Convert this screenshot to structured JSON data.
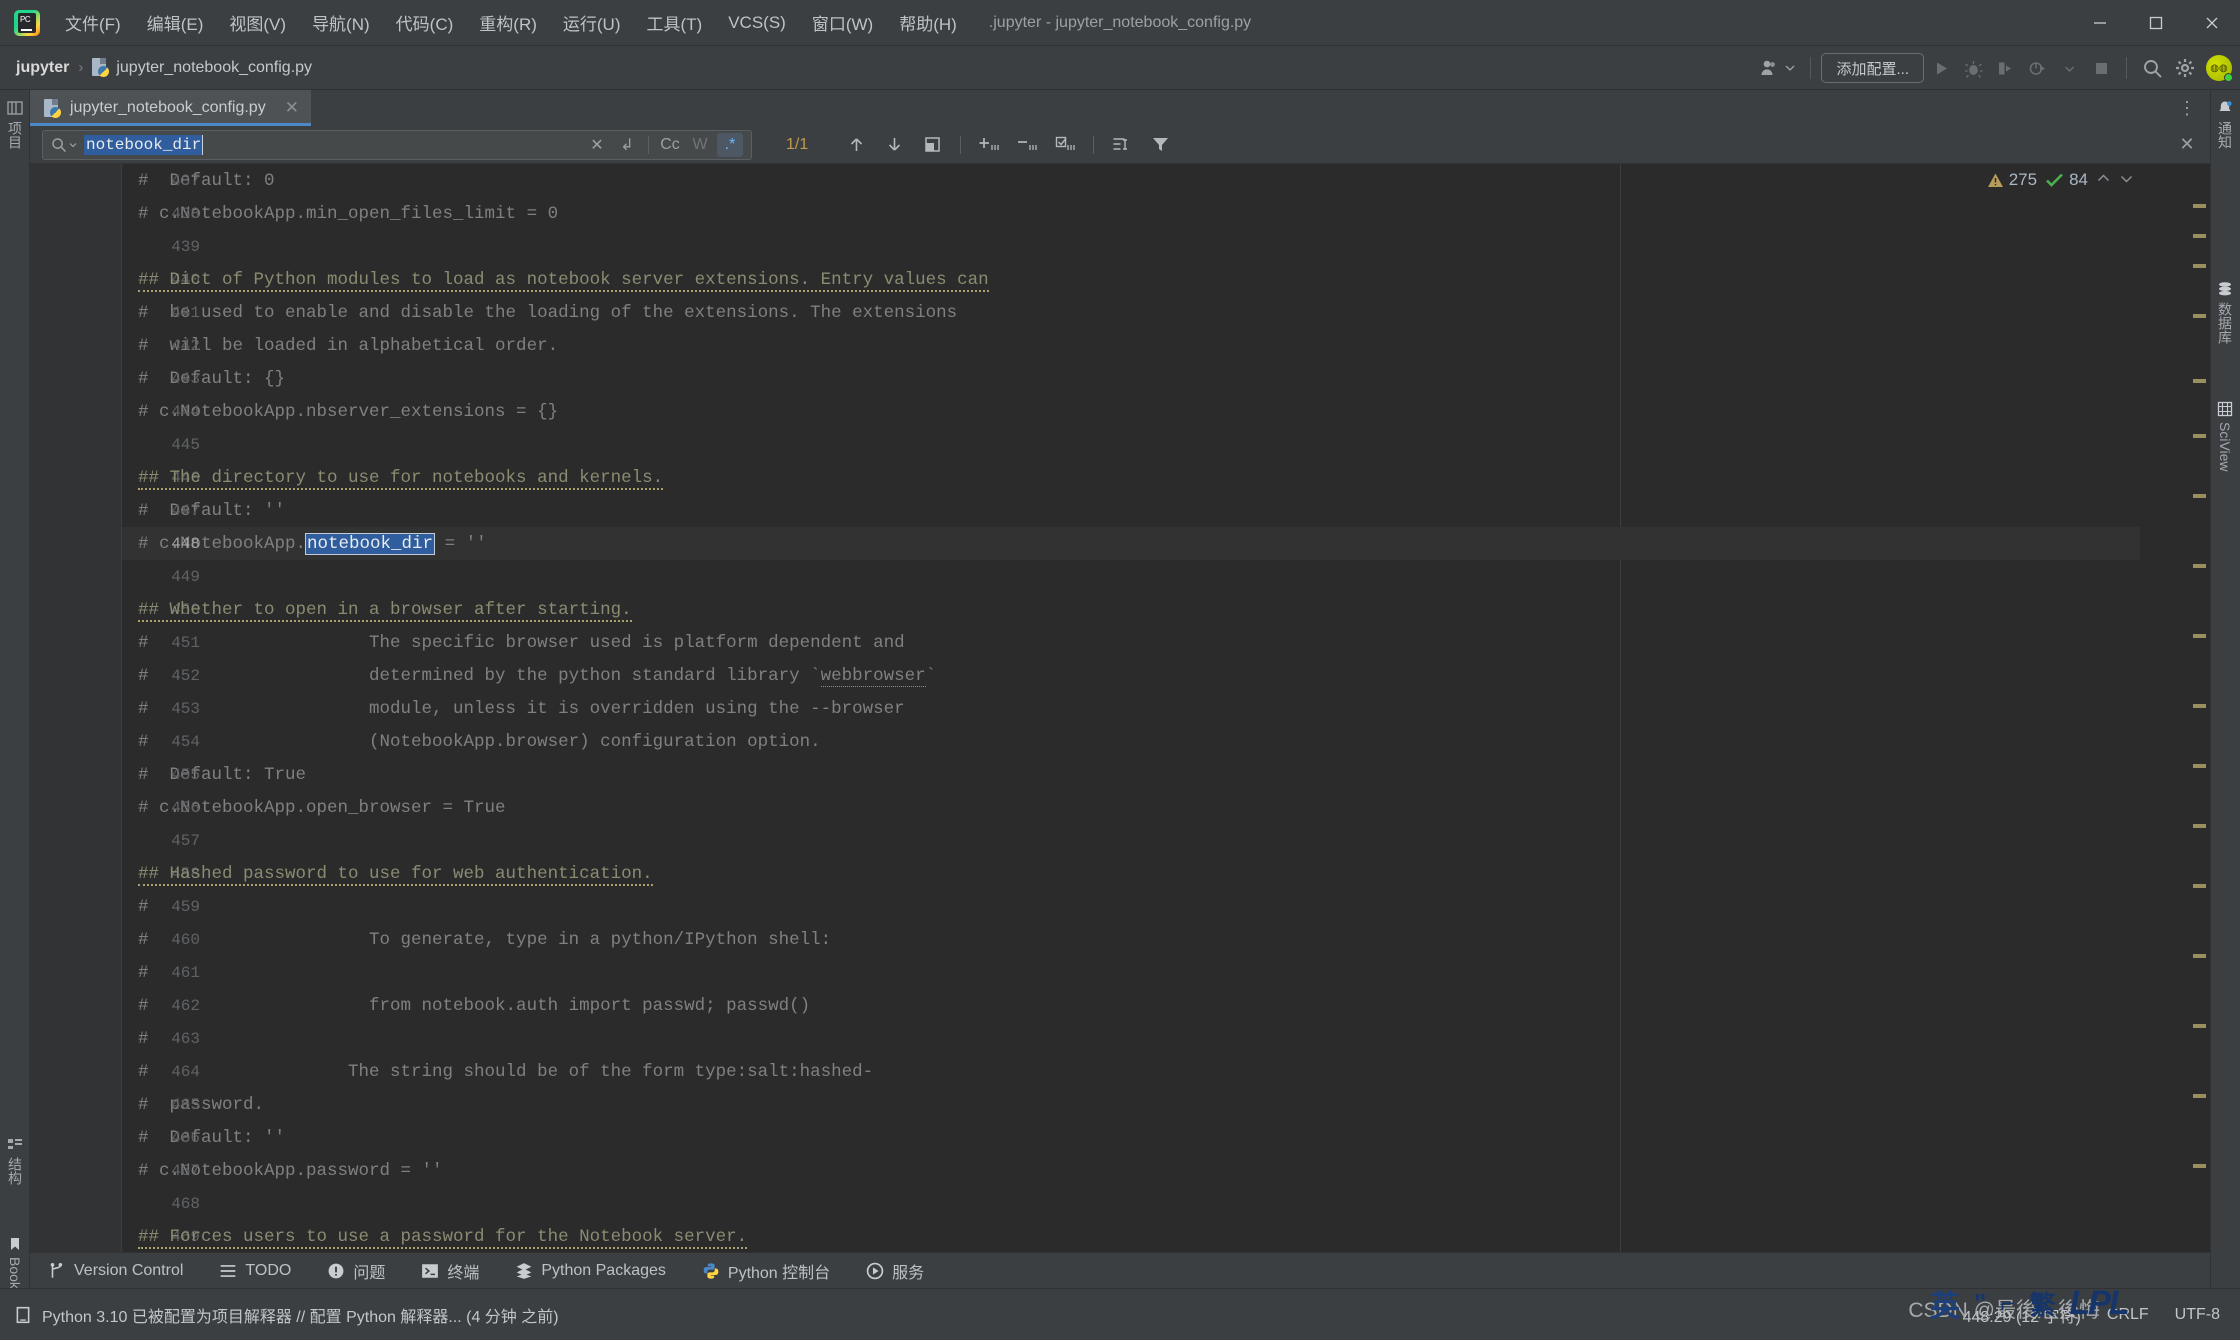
{
  "window": {
    "title": ".jupyter - jupyter_notebook_config.py",
    "minimize_label": "minimize",
    "maximize_label": "maximize",
    "close_label": "close"
  },
  "menubar": {
    "items": [
      {
        "label": "文件(F)",
        "name": "menu-file"
      },
      {
        "label": "编辑(E)",
        "name": "menu-edit"
      },
      {
        "label": "视图(V)",
        "name": "menu-view"
      },
      {
        "label": "导航(N)",
        "name": "menu-navigate"
      },
      {
        "label": "代码(C)",
        "name": "menu-code"
      },
      {
        "label": "重构(R)",
        "name": "menu-refactor"
      },
      {
        "label": "运行(U)",
        "name": "menu-run"
      },
      {
        "label": "工具(T)",
        "name": "menu-tools"
      },
      {
        "label": "VCS(S)",
        "name": "menu-vcs"
      },
      {
        "label": "窗口(W)",
        "name": "menu-window"
      },
      {
        "label": "帮助(H)",
        "name": "menu-help"
      }
    ]
  },
  "navbar": {
    "crumb_root": "jupyter",
    "crumb_sep": "›",
    "crumb_file": "jupyter_notebook_config.py",
    "add_config_label": "添加配置..."
  },
  "left_stripe": {
    "project_label": "项目",
    "structure_label": "结构",
    "bookmarks_label": "Bookmarks"
  },
  "right_stripe": {
    "notifications_label": "通知",
    "database_label": "数据库",
    "sciview_label": "SciView"
  },
  "editor_tabs": {
    "active_tab": "jupyter_notebook_config.py",
    "close_glyph": "✕",
    "kebab_glyph": "⋮"
  },
  "findbar": {
    "query": "notebook_dir",
    "clear_glyph": "✕",
    "history_glyph": "↲",
    "match_case_label": "Cc",
    "words_label": "W",
    "regex_label": ".*",
    "match_count": "1/1",
    "prev_title": "上一个",
    "next_title": "下一个",
    "close_glyph": "✕"
  },
  "inspections": {
    "warning_count": "275",
    "ok_count": "84"
  },
  "editor": {
    "lines": [
      {
        "no": "437",
        "text": "#  Default: 0",
        "kind": "comment"
      },
      {
        "no": "438",
        "text": "# c.NotebookApp.min_open_files_limit = 0",
        "kind": "comment"
      },
      {
        "no": "439",
        "text": "",
        "kind": "blank"
      },
      {
        "no": "440",
        "text": "## Dict of Python modules to load as notebook server extensions. Entry values can",
        "kind": "doc"
      },
      {
        "no": "441",
        "text": "#  be used to enable and disable the loading of the extensions. The extensions",
        "kind": "comment"
      },
      {
        "no": "442",
        "text": "#  will be loaded in alphabetical order.",
        "kind": "comment"
      },
      {
        "no": "443",
        "text": "#  Default: {}",
        "kind": "comment"
      },
      {
        "no": "444",
        "text": "# c.NotebookApp.nbserver_extensions = {}",
        "kind": "comment"
      },
      {
        "no": "445",
        "text": "",
        "kind": "blank"
      },
      {
        "no": "446",
        "text": "## The directory to use for notebooks and kernels.",
        "kind": "doc"
      },
      {
        "no": "447",
        "text": "#  Default: ''",
        "kind": "comment"
      },
      {
        "no": "448",
        "text": "# c.NotebookApp.notebook_dir = ''",
        "kind": "match",
        "prefix": "# c.NotebookApp.",
        "match": "notebook_dir",
        "suffix": " = ''"
      },
      {
        "no": "449",
        "text": "",
        "kind": "blank"
      },
      {
        "no": "450",
        "text": "## Whether to open in a browser after starting.",
        "kind": "doc"
      },
      {
        "no": "451",
        "text": "#                     The specific browser used is platform dependent and",
        "kind": "comment"
      },
      {
        "no": "452",
        "text": "#                     determined by the python standard library `webbrowser`",
        "kind": "comment-webbrowser"
      },
      {
        "no": "453",
        "text": "#                     module, unless it is overridden using the --browser",
        "kind": "comment"
      },
      {
        "no": "454",
        "text": "#                     (NotebookApp.browser) configuration option.",
        "kind": "comment"
      },
      {
        "no": "455",
        "text": "#  Default: True",
        "kind": "comment"
      },
      {
        "no": "456",
        "text": "# c.NotebookApp.open_browser = True",
        "kind": "comment"
      },
      {
        "no": "457",
        "text": "",
        "kind": "blank"
      },
      {
        "no": "458",
        "text": "## Hashed password to use for web authentication.",
        "kind": "doc"
      },
      {
        "no": "459",
        "text": "#",
        "kind": "comment"
      },
      {
        "no": "460",
        "text": "#                     To generate, type in a python/IPython shell:",
        "kind": "comment"
      },
      {
        "no": "461",
        "text": "#",
        "kind": "comment"
      },
      {
        "no": "462",
        "text": "#                     from notebook.auth import passwd; passwd()",
        "kind": "comment"
      },
      {
        "no": "463",
        "text": "#",
        "kind": "comment"
      },
      {
        "no": "464",
        "text": "#                   The string should be of the form type:salt:hashed-",
        "kind": "comment"
      },
      {
        "no": "465",
        "text": "#  password.",
        "kind": "comment"
      },
      {
        "no": "466",
        "text": "#  Default: ''",
        "kind": "comment"
      },
      {
        "no": "467",
        "text": "# c.NotebookApp.password = ''",
        "kind": "comment"
      },
      {
        "no": "468",
        "text": "",
        "kind": "blank"
      },
      {
        "no": "469",
        "text": "## Forces users to use a password for the Notebook server.",
        "kind": "doc"
      }
    ],
    "webbrowser_token": "webbrowser"
  },
  "bottom_tools": [
    {
      "label": "Version Control",
      "name": "bottom-tool-version-control"
    },
    {
      "label": "TODO",
      "name": "bottom-tool-todo"
    },
    {
      "label": "问题",
      "name": "bottom-tool-problems"
    },
    {
      "label": "终端",
      "name": "bottom-tool-terminal"
    },
    {
      "label": "Python Packages",
      "name": "bottom-tool-python-packages"
    },
    {
      "label": "Python 控制台",
      "name": "bottom-tool-python-console"
    },
    {
      "label": "服务",
      "name": "bottom-tool-services"
    }
  ],
  "statusbar": {
    "message": "Python 3.10 已被配置为项目解释器 // 配置 Python 解释器... (4 分钟 之前)",
    "caret": "448:29 (12 字符)",
    "line_sep": "CRLF",
    "encoding": "UTF-8"
  },
  "watermark": {
    "csdn": "CSDN @最後灬後悔",
    "ime_lang": "英",
    "ime_punct": "\"",
    "ime_half": "⌐",
    "ime_trad": "繁",
    "ime_logo": "LPL"
  },
  "colors": {
    "accent": "#4a88c7",
    "match_highlight": "#2f5d9e",
    "warning": "#a9b7c6",
    "editor_bg": "#2b2b2b",
    "chrome_bg": "#3c3f41"
  }
}
